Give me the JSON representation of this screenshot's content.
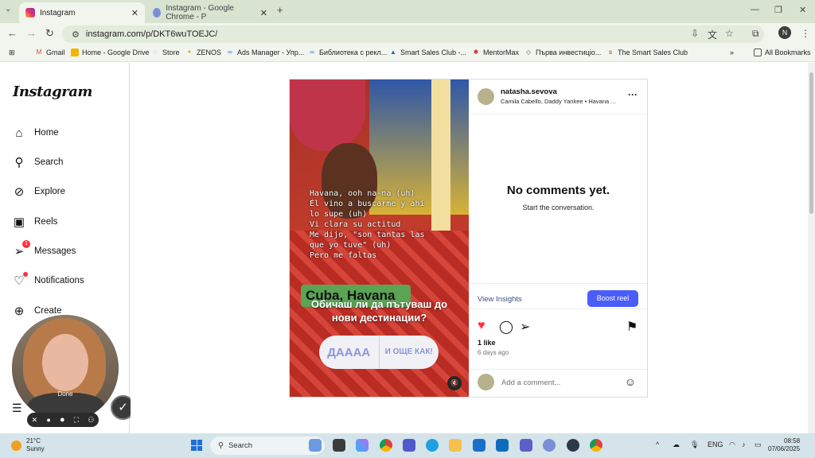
{
  "browser": {
    "tabs": [
      {
        "title": "Instagram",
        "active": true
      },
      {
        "title": "Instagram - Google Chrome - P",
        "active": false
      }
    ],
    "url": "instagram.com/p/DKT6wuTOEJC/",
    "bookmarks": [
      "Gmail",
      "Home - Google Drive",
      "Store",
      "ZENOS",
      "Ads Manager - Упр...",
      "Библиотека с рекл...",
      "Smart Sales Club -...",
      "MentorMax",
      "Първа инвестиціо...",
      "The Smart Sales Club"
    ],
    "all_bookmarks": "All Bookmarks",
    "profile_initial": "N"
  },
  "sidebar": {
    "logo": "Instagram",
    "items": [
      {
        "label": "Home",
        "icon": "home-icon"
      },
      {
        "label": "Search",
        "icon": "search-icon"
      },
      {
        "label": "Explore",
        "icon": "compass-icon"
      },
      {
        "label": "Reels",
        "icon": "reels-icon"
      },
      {
        "label": "Messages",
        "icon": "messages-icon",
        "badge": "1"
      },
      {
        "label": "Notifications",
        "icon": "heart-icon"
      },
      {
        "label": "Create",
        "icon": "plus-icon"
      }
    ]
  },
  "webcam": {
    "label": "Done"
  },
  "post": {
    "lyrics": "Havana, ooh na-na (uh)\nÉl vino a buscarme y ahí\nlo supe (uh)\nVi clara su actitud\nMe dijo, \"son tantas las\nque yo tuve\" (uh)\nPero me faltas",
    "sticker": "Cuba, Havana",
    "question_line1": "Обичаш ли да пътуваш до",
    "question_line2": "нови дестинации?",
    "answer1": "ДАААА",
    "answer2": "И ОЩЕ КАК!",
    "username": "natasha.sevova",
    "audio": "Camila Cabello, Daddy Yankee • Havana ...",
    "no_comments": "No comments yet.",
    "start_conversation": "Start the conversation.",
    "view_insights": "View Insights",
    "boost": "Boost reel",
    "likes": "1 like",
    "time_ago": "6 days ago",
    "add_comment_placeholder": "Add a comment..."
  },
  "taskbar": {
    "temperature": "21°C",
    "weather": "Sunny",
    "search": "Search",
    "lang": "ENG",
    "time": "08:58",
    "date": "07/06/2025"
  }
}
